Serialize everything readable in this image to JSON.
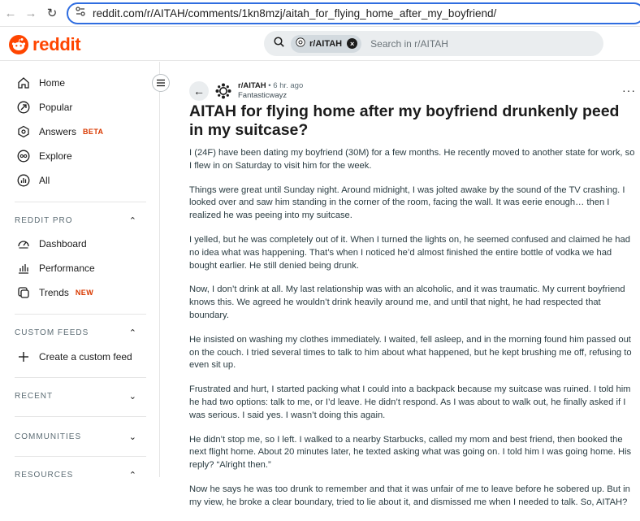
{
  "browser": {
    "url": "reddit.com/r/AITAH/comments/1kn8mzj/aitah_for_flying_home_after_my_boyfriend/"
  },
  "header": {
    "logo_text": "reddit",
    "search_chip": "r/AITAH",
    "search_placeholder": "Search in r/AITAH"
  },
  "sidebar": {
    "items": [
      {
        "label": "Home",
        "icon": "home-icon"
      },
      {
        "label": "Popular",
        "icon": "popular-icon"
      },
      {
        "label": "Answers",
        "tag": "BETA",
        "icon": "answers-icon"
      },
      {
        "label": "Explore",
        "icon": "explore-icon"
      },
      {
        "label": "All",
        "icon": "all-icon"
      }
    ],
    "reddit_pro": {
      "title": "REDDIT PRO",
      "items": [
        {
          "label": "Dashboard",
          "icon": "dashboard-icon"
        },
        {
          "label": "Performance",
          "icon": "performance-icon"
        },
        {
          "label": "Trends",
          "tag": "NEW",
          "icon": "trends-icon"
        }
      ]
    },
    "custom_feeds": {
      "title": "CUSTOM FEEDS",
      "create_label": "Create a custom feed"
    },
    "recent": {
      "title": "RECENT"
    },
    "communities": {
      "title": "COMMUNITIES"
    },
    "resources": {
      "title": "RESOURCES"
    }
  },
  "post": {
    "subreddit": "r/AITAH",
    "separator": "•",
    "age": "6 hr. ago",
    "author": "Fantasticwayz",
    "title": "AITAH for flying home after my boyfriend drunkenly peed in my suitcase?",
    "paragraphs": [
      "I (24F) have been dating my boyfriend (30M) for a few months. He recently moved to another state for work, so I flew in on Saturday to visit him for the week.",
      "Things were great until Sunday night. Around midnight, I was jolted awake by the sound of the TV crashing. I looked over and saw him standing in the corner of the room, facing the wall. It was eerie enough… then I realized he was peeing into my suitcase.",
      "I yelled, but he was completely out of it. When I turned the lights on, he seemed confused and claimed he had no idea what was happening. That’s when I noticed he’d almost finished the entire bottle of vodka we had bought earlier. He still denied being drunk.",
      "Now, I don’t drink at all. My last relationship was with an alcoholic, and it was traumatic. My current boyfriend knows this. We agreed he wouldn’t drink heavily around me, and until that night, he had respected that boundary.",
      "He insisted on washing my clothes immediately. I waited, fell asleep, and in the morning found him passed out on the couch. I tried several times to talk to him about what happened, but he kept brushing me off, refusing to even sit up.",
      "Frustrated and hurt, I started packing what I could into a backpack because my suitcase was ruined. I told him he had two options: talk to me, or I’d leave. He didn’t respond. As I was about to walk out, he finally asked if I was serious. I said yes. I wasn’t doing this again.",
      "He didn’t stop me, so I left. I walked to a nearby Starbucks, called my mom and best friend, then booked the next flight home. About 20 minutes later, he texted asking what was going on. I told him I was going home. His reply? “Alright then.”",
      "Now he says he was too drunk to remember and that it was unfair of me to leave before he sobered up. But in my view, he broke a clear boundary, tried to lie about it, and dismissed me when I needed to talk. So, AITAH?"
    ]
  },
  "colors": {
    "brand": "#ff4500",
    "url_focus": "#2f6de0",
    "tag": "#d93900"
  }
}
